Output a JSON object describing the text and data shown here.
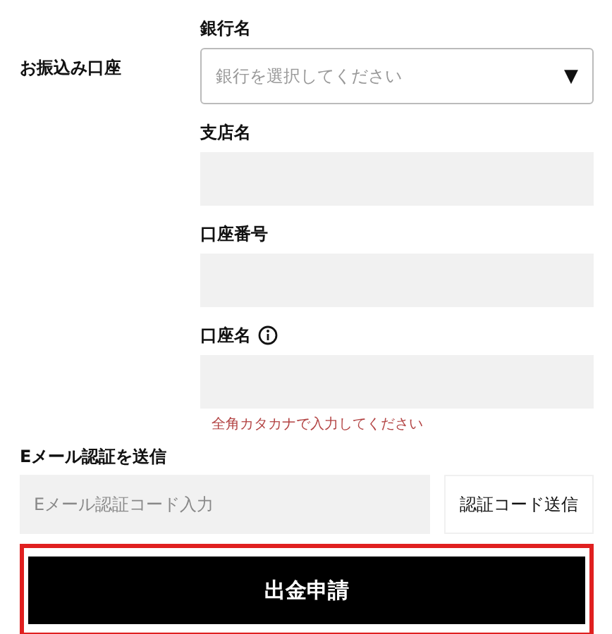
{
  "section_label": "お振込み口座",
  "fields": [
    {
      "kind": "select",
      "label": "銀行名",
      "placeholder": "銀行を選択してください",
      "caret": "▼"
    },
    {
      "kind": "text",
      "label": "支店名"
    },
    {
      "kind": "text",
      "label": "口座番号"
    },
    {
      "kind": "text",
      "label": "口座名",
      "info": true,
      "hint": "全角カタカナで入力してください"
    }
  ],
  "email": {
    "label": "Eメール認証を送信",
    "placeholder": "Eメール認証コード入力",
    "button": "認証コード送信"
  },
  "submit": {
    "label": "出金申請",
    "highlighted": true
  }
}
